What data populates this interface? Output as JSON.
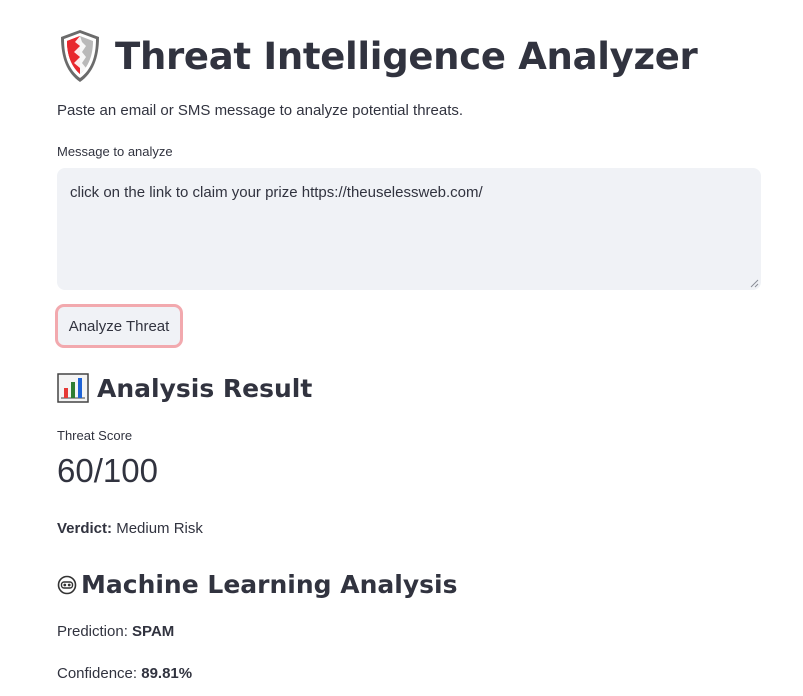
{
  "header": {
    "title": "Threat Intelligence Analyzer",
    "icon": "shield-icon"
  },
  "intro": "Paste an email or SMS message to analyze potential threats.",
  "input": {
    "label": "Message to analyze",
    "value": "click on the link to claim your prize https://theuselessweb.com/"
  },
  "analyze_button": {
    "label": "Analyze Threat",
    "border_color": "#f2a9ae"
  },
  "result": {
    "heading": "Analysis Result",
    "icon": "bar-chart-icon",
    "metric_label": "Threat Score",
    "metric_value": "60/100",
    "verdict_label": "Verdict:",
    "verdict_value": "Medium Risk"
  },
  "ml": {
    "heading": "Machine Learning Analysis",
    "icon": "robot-icon",
    "prediction_label": "Prediction:",
    "prediction_value": "SPAM",
    "confidence_label": "Confidence:",
    "confidence_value": "89.81%"
  },
  "colors": {
    "text": "#31333f",
    "input_bg": "#f0f2f6",
    "shield_red": "#e8272e"
  }
}
